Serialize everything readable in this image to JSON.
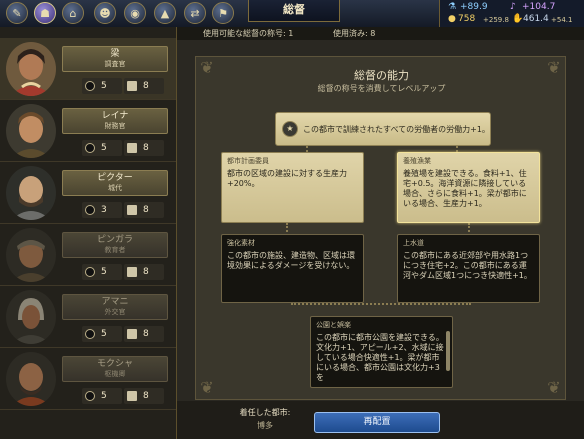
{
  "header": {
    "title": "総督",
    "nav_icons": [
      "civics-icon",
      "religion-icon",
      "government-icon",
      "great-people-icon",
      "great-works-icon",
      "climate-icon",
      "trade-route-icon",
      "governor-icon"
    ]
  },
  "yields": {
    "science": "+89.9",
    "culture": "+104.7",
    "gold": "758",
    "gold_rate": "+259.8",
    "faith": "461.4",
    "faith_rate": "+54.1"
  },
  "subheader": {
    "available": "使用可能な総督の称号: 1",
    "used": "使用済み: 8"
  },
  "governors": [
    {
      "name": "梁",
      "title": "調査官",
      "promotions": "5",
      "flags": "8",
      "selected": true
    },
    {
      "name": "レイナ",
      "title": "財務官",
      "promotions": "5",
      "flags": "8",
      "selected": false
    },
    {
      "name": "ピクター",
      "title": "城代",
      "promotions": "3",
      "flags": "8",
      "selected": false
    },
    {
      "name": "ピンガラ",
      "title": "教育者",
      "promotions": "5",
      "flags": "8",
      "selected": false
    },
    {
      "name": "アマニ",
      "title": "外交官",
      "promotions": "5",
      "flags": "8",
      "selected": false
    },
    {
      "name": "モクシャ",
      "title": "枢機卿",
      "promotions": "5",
      "flags": "8",
      "selected": false
    }
  ],
  "panel": {
    "title": "総督の能力",
    "subtitle": "総督の称号を消費してレベルアップ",
    "root_ability": "この都市で訓練されたすべての労働者の労働力+1。",
    "abilities": [
      {
        "id": "city-planning",
        "name": "都市計画委員",
        "desc": "都市の区域の建設に対する生産力+20%。",
        "state": "unlocked"
      },
      {
        "id": "aquaculture",
        "name": "養殖漁業",
        "desc": "養殖場を建設できる。食料+1、住宅+0.5。海洋資源に隣接している場合、さらに食料+1。梁が都市にいる場合、生産力+1。",
        "state": "unlocked"
      },
      {
        "id": "reinforced-materials",
        "name": "強化素材",
        "desc": "この都市の施設、建造物、区域は環境効果によるダメージを受けない。",
        "state": "locked"
      },
      {
        "id": "water-works",
        "name": "上水道",
        "desc": "この都市にある近郊部や用水路1つにつき住宅+2。この都市にある運河やダム区域1つにつき快適性+1。",
        "state": "locked"
      },
      {
        "id": "parks-recreation",
        "name": "公園と娯楽",
        "desc": "この都市に都市公園を建設できる。文化力+1、アピール+2、水域に接している場合快適性+1。梁が都市にいる場合、都市公園は文化力+3を",
        "state": "locked"
      }
    ]
  },
  "footer": {
    "assigned_label": "着任した都市:",
    "assigned_city": "博多",
    "reassign_button": "再配置"
  }
}
